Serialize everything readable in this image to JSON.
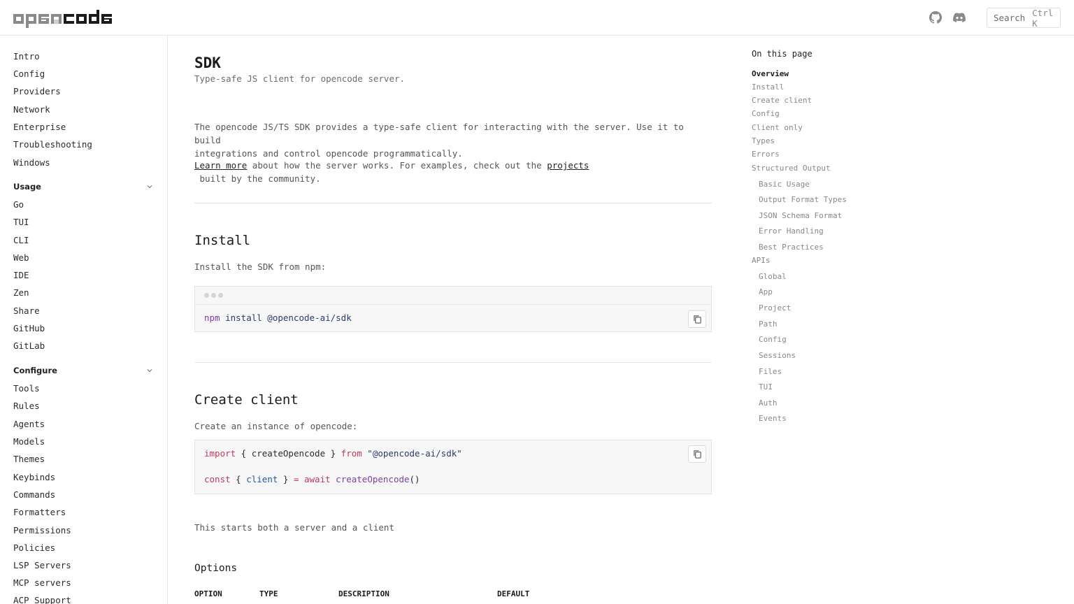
{
  "header": {
    "logo_text": "opencode",
    "search_label": "Search",
    "search_shortcut": "Ctrl K",
    "icons": [
      "github-icon",
      "discord-icon"
    ]
  },
  "sidebar": {
    "top_items": [
      "Intro",
      "Config",
      "Providers",
      "Network",
      "Enterprise",
      "Troubleshooting",
      "Windows"
    ],
    "groups": [
      {
        "label": "Usage",
        "items": [
          "Go",
          "TUI",
          "CLI",
          "Web",
          "IDE",
          "Zen",
          "Share",
          "GitHub",
          "GitLab"
        ]
      },
      {
        "label": "Configure",
        "items": [
          "Tools",
          "Rules",
          "Agents",
          "Models",
          "Themes",
          "Keybinds",
          "Commands",
          "Formatters",
          "Permissions",
          "Policies",
          "LSP Servers",
          "MCP servers",
          "ACP Support"
        ]
      }
    ]
  },
  "main": {
    "title": "SDK",
    "subtitle": "Type-safe JS client for opencode server.",
    "intro_line1": "The opencode JS/TS SDK provides a type-safe client for interacting with the server. Use it to build",
    "intro_line2": "integrations and control opencode programmatically.",
    "learn_more_link": "Learn more",
    "learn_more_mid": " about how the server works. For examples, check out the ",
    "projects_link": "projects",
    "learn_more_end": " built by the community.",
    "install": {
      "heading": "Install",
      "text": "Install the SDK from npm:",
      "code_cmd": "npm",
      "code_rest": " install @opencode-ai/sdk"
    },
    "create_client": {
      "heading": "Create client",
      "text": "Create an instance of opencode:",
      "line1": {
        "kw1": "import",
        "mid1": " { createOpencode } ",
        "kw2": "from",
        "str": " \"@opencode-ai/sdk\""
      },
      "line2": {
        "kw1": "const",
        "mid1": " { ",
        "var": "client",
        "mid2": " } ",
        "op": "=",
        "kw2": " await",
        "fn": " createOpencode",
        "end": "()"
      },
      "after_text": "This starts both a server and a client"
    },
    "options": {
      "heading": "Options",
      "columns": [
        "OPTION",
        "TYPE",
        "DESCRIPTION",
        "DEFAULT"
      ]
    }
  },
  "toc": {
    "title": "On this page",
    "items": [
      {
        "label": "Overview",
        "level": 1,
        "active": true
      },
      {
        "label": "Install",
        "level": 1
      },
      {
        "label": "Create client",
        "level": 1
      },
      {
        "label": "Config",
        "level": 1
      },
      {
        "label": "Client only",
        "level": 1
      },
      {
        "label": "Types",
        "level": 1
      },
      {
        "label": "Errors",
        "level": 1
      },
      {
        "label": "Structured Output",
        "level": 1
      },
      {
        "label": "Basic Usage",
        "level": 2
      },
      {
        "label": "Output Format Types",
        "level": 2
      },
      {
        "label": "JSON Schema Format",
        "level": 2
      },
      {
        "label": "Error Handling",
        "level": 2
      },
      {
        "label": "Best Practices",
        "level": 2
      },
      {
        "label": "APIs",
        "level": 1
      },
      {
        "label": "Global",
        "level": 2
      },
      {
        "label": "App",
        "level": 2
      },
      {
        "label": "Project",
        "level": 2
      },
      {
        "label": "Path",
        "level": 2
      },
      {
        "label": "Config",
        "level": 2
      },
      {
        "label": "Sessions",
        "level": 2
      },
      {
        "label": "Files",
        "level": 2
      },
      {
        "label": "TUI",
        "level": 2
      },
      {
        "label": "Auth",
        "level": 2
      },
      {
        "label": "Events",
        "level": 2
      }
    ]
  }
}
